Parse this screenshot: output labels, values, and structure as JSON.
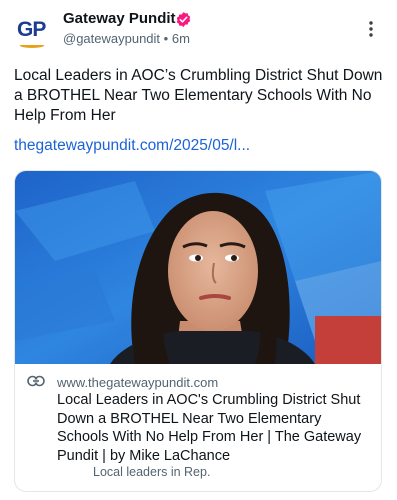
{
  "account": {
    "name": "Gateway Pundit",
    "handle": "@gatewaypundit",
    "separator": "•",
    "time": "6m",
    "avatar_text": "GP"
  },
  "post": {
    "text": "Local Leaders in AOC’s Crumbling District Shut Down a BROTHEL Near Two Elementary Schools With No Help From Her",
    "link": "thegatewaypundit.com/2025/05/l..."
  },
  "card": {
    "domain": "www.thegatewaypundit.com",
    "title": "Local Leaders in AOC's Crumbling District Shut Down a BROTHEL Near Two Elementary Schools With No Help From Her | The Gateway Pundit | by Mike LaChance",
    "description": "Local leaders in Rep."
  },
  "colors": {
    "verified_badge": "#f91880",
    "link": "#1b63d6",
    "secondary_text": "#536471",
    "brand_blue": "#1c3d8f",
    "brand_orange": "#e8a21a"
  },
  "icons": {
    "verified": "verified-badge-icon",
    "more": "more-vertical-icon",
    "link": "link-icon"
  }
}
